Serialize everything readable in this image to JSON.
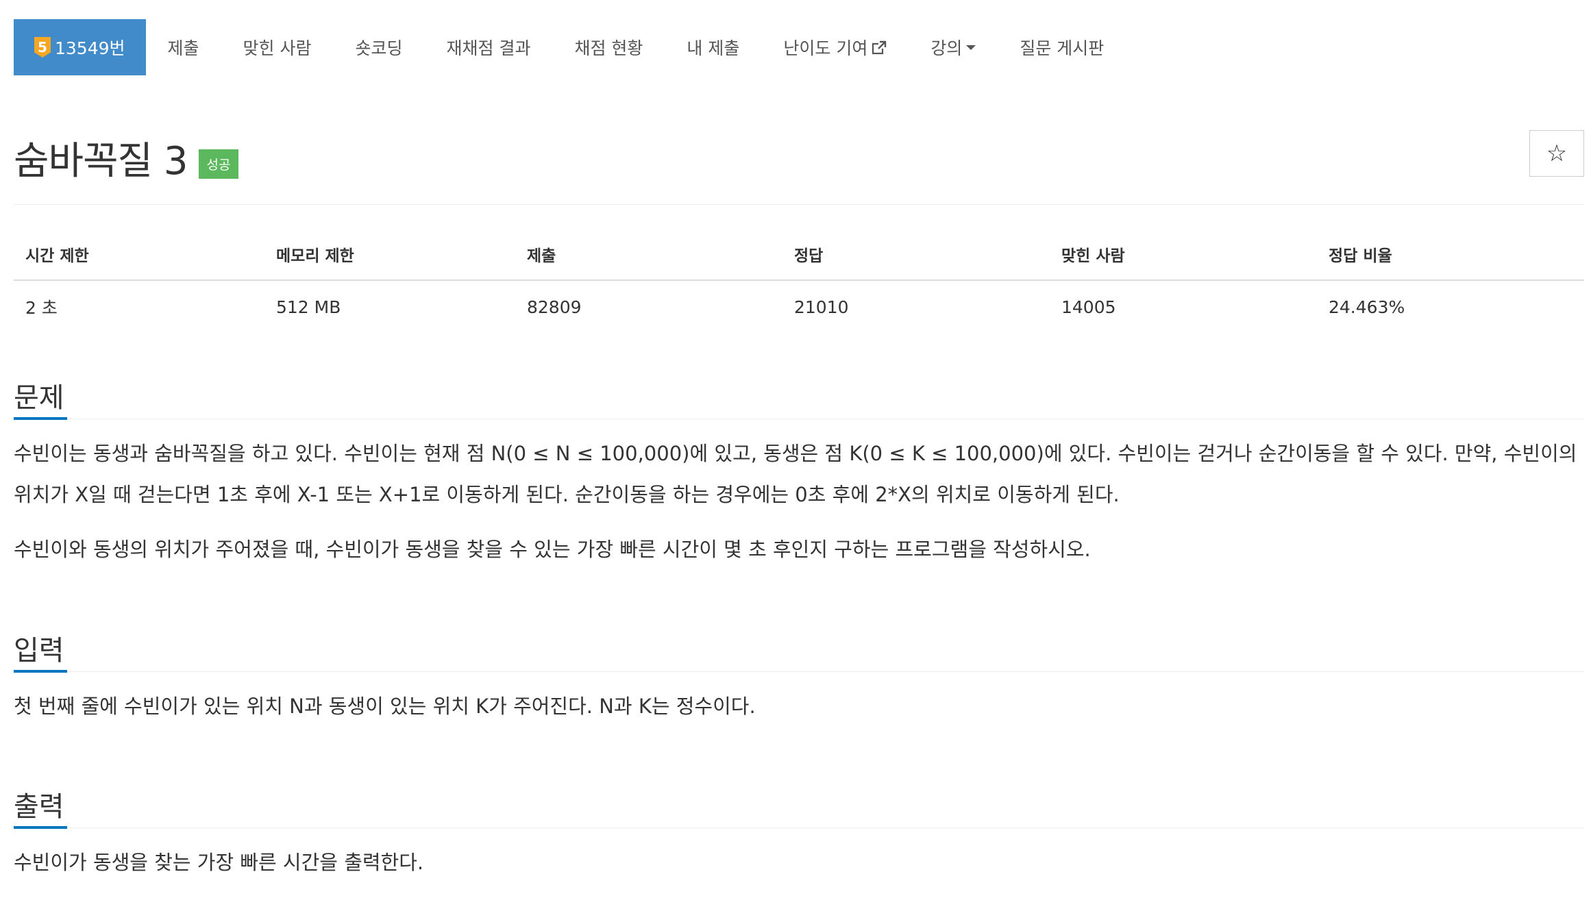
{
  "nav": {
    "problem_id_tab": {
      "tier": "5",
      "label": "13549번",
      "tier_color": "#f5a623"
    },
    "items": [
      {
        "label": "제출"
      },
      {
        "label": "맞힌 사람"
      },
      {
        "label": "숏코딩"
      },
      {
        "label": "재채점 결과"
      },
      {
        "label": "채점 현황"
      },
      {
        "label": "내 제출"
      },
      {
        "label": "난이도 기여",
        "icon": "external-link-icon"
      },
      {
        "label": "강의",
        "icon": "caret-down-icon"
      },
      {
        "label": "질문 게시판"
      }
    ],
    "active_color": "#428bca"
  },
  "problem": {
    "title": "숨바꼭질 3",
    "result_badge": "성공",
    "result_color": "#5cb85c",
    "star_icon": "star-icon",
    "star_glyph": "☆"
  },
  "info_table": {
    "headers": [
      "시간 제한",
      "메모리 제한",
      "제출",
      "정답",
      "맞힌 사람",
      "정답 비율"
    ],
    "values": [
      "2 초",
      "512 MB",
      "82809",
      "21010",
      "14005",
      "24.463%"
    ]
  },
  "sections": {
    "description": {
      "title": "문제",
      "paragraphs": [
        "수빈이는 동생과 숨바꼭질을 하고 있다. 수빈이는 현재 점 N(0 ≤ N ≤ 100,000)에 있고, 동생은 점 K(0 ≤ K ≤ 100,000)에 있다. 수빈이는 걷거나 순간이동을 할 수 있다. 만약, 수빈이의 위치가 X일 때 걷는다면 1초 후에 X-1 또는 X+1로 이동하게 된다. 순간이동을 하는 경우에는 0초 후에 2*X의 위치로 이동하게 된다.",
        "수빈이와 동생의 위치가 주어졌을 때, 수빈이가 동생을 찾을 수 있는 가장 빠른 시간이 몇 초 후인지 구하는 프로그램을 작성하시오."
      ]
    },
    "input": {
      "title": "입력",
      "paragraphs": [
        "첫 번째 줄에 수빈이가 있는 위치 N과 동생이 있는 위치 K가 주어진다. N과 K는 정수이다."
      ]
    },
    "output": {
      "title": "출력",
      "paragraphs": [
        "수빈이가 동생을 찾는 가장 빠른 시간을 출력한다."
      ]
    }
  }
}
